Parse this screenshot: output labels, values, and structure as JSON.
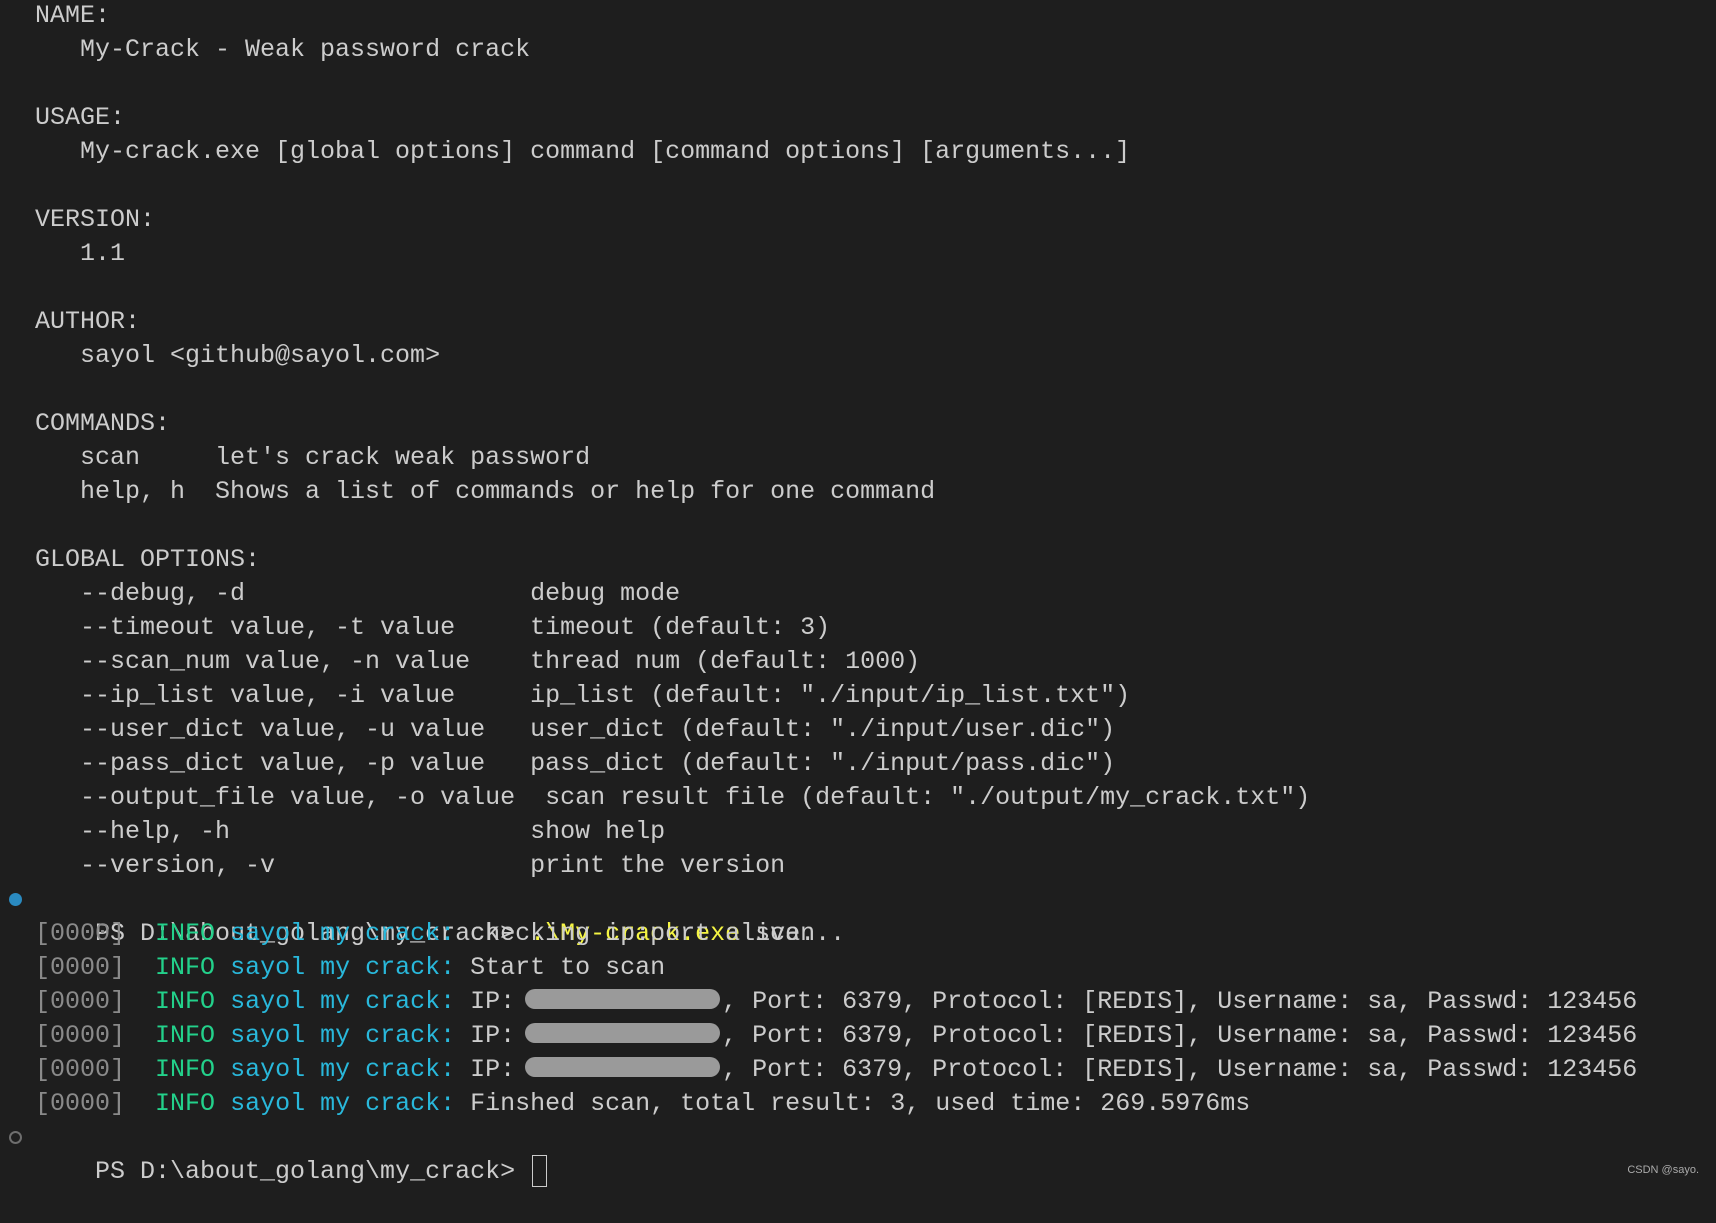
{
  "help_lines": [
    "NAME:",
    "   My-Crack - Weak password crack",
    "",
    "USAGE:",
    "   My-crack.exe [global options] command [command options] [arguments...]",
    "",
    "VERSION:",
    "   1.1",
    "",
    "AUTHOR:",
    "   sayol <github@sayol.com>",
    "",
    "COMMANDS:",
    "   scan     let's crack weak password",
    "   help, h  Shows a list of commands or help for one command",
    "",
    "GLOBAL OPTIONS:",
    "   --debug, -d                   debug mode",
    "   --timeout value, -t value     timeout (default: 3)",
    "   --scan_num value, -n value    thread num (default: 1000)",
    "   --ip_list value, -i value     ip_list (default: \"./input/ip_list.txt\")",
    "   --user_dict value, -u value   user_dict (default: \"./input/user.dic\")",
    "   --pass_dict value, -p value   pass_dict (default: \"./input/pass.dic\")",
    "   --output_file value, -o value  scan result file (default: \"./output/my_crack.txt\")",
    "   --help, -h                    show help",
    "   --version, -v                 print the version"
  ],
  "prompt": "PS D:\\about_golang\\my_crack> ",
  "command": ".\\My-crack.exe",
  "command_args": " scan",
  "log": {
    "tag": "[0000]",
    "level": "INFO",
    "source": "sayol my crack:",
    "messages": [
      {
        "text": "checking ip:port alive..."
      },
      {
        "text": "Start to scan"
      },
      {
        "ip_label": "IP:",
        "text": ", Port: 6379, Protocol: [REDIS], Username: sa, Passwd: 123456"
      },
      {
        "ip_label": "IP:",
        "text": ", Port: 6379, Protocol: [REDIS], Username: sa, Passwd: 123456"
      },
      {
        "ip_label": "IP:",
        "text": ", Port: 6379, Protocol: [REDIS], Username: sa, Passwd: 123456"
      },
      {
        "text": "Finshed scan, total result: 3, used time: 269.5976ms"
      }
    ]
  },
  "watermark": "CSDN @sayo.",
  "colors": {
    "background": "#1e1e1e",
    "info": "#23d18b",
    "source": "#29b8db",
    "command": "#f5f543",
    "success_dot": "#2a8ac0"
  }
}
